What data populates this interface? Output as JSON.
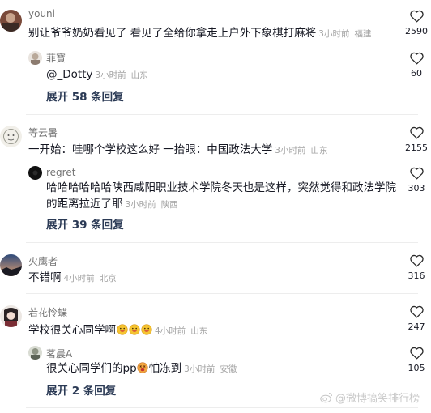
{
  "comments": [
    {
      "user": "youni",
      "text": "别让爷爷奶奶看见了 看见了全给你拿走上户外下象棋打麻将",
      "time": "3小时前",
      "location": "福建",
      "likes": "2590",
      "reply": {
        "user": "菲寶",
        "text": "@_Dotty",
        "time": "3小时前",
        "location": "山东",
        "likes": "60"
      },
      "expand": "展开 58 条回复"
    },
    {
      "user": "等云暑",
      "text": "一开始：哇哪个学校这么好 一抬眼：中国政法大学",
      "time": "3小时前",
      "location": "山东",
      "likes": "2155",
      "reply": {
        "user": "regret",
        "text": "哈哈哈哈哈哈陕西咸阳职业技术学院冬天也是这样，突然觉得和政法学院的距离拉近了耶",
        "time": "3小时前",
        "location": "陕西",
        "likes": "303"
      },
      "expand": "展开 39 条回复"
    },
    {
      "user": "火鹰者",
      "text": "不错啊",
      "time": "4小时前",
      "location": "北京",
      "likes": "316"
    },
    {
      "user": "若花怜蝶",
      "text": "学校很关心同学啊",
      "time": "4小时前",
      "location": "山东",
      "likes": "247",
      "reply": {
        "user": "茗晨A",
        "text_before": "很关心同学们的pp",
        "text_after": "怕冻到",
        "time": "3小时前",
        "location": "安徽",
        "likes": "105"
      },
      "expand": "展开 2 条回复"
    }
  ],
  "watermark": "@微博搞笑排行榜",
  "icons": {
    "like": "heart-outline-icon",
    "emoji_grin": "grinning-face-emoji",
    "emoji_dizzy": "dizzy-face-emoji",
    "weibo": "weibo-logo-icon"
  },
  "colors": {
    "expand_text": "#2b3a55",
    "meta_text": "#a3a3a3",
    "username": "#737373"
  }
}
